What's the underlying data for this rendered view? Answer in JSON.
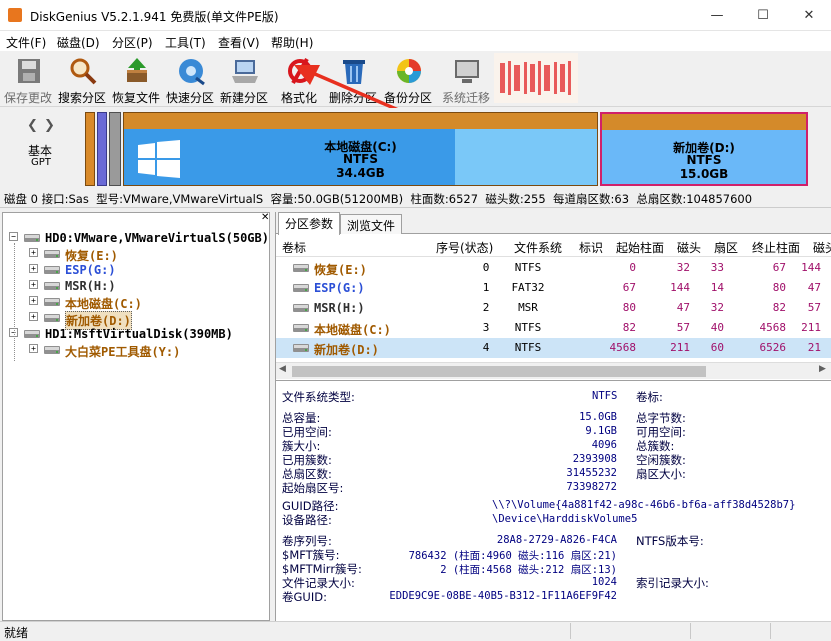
{
  "window": {
    "title": "DiskGenius V5.2.1.941 免费版(单文件PE版)"
  },
  "menu": [
    "文件(F)",
    "磁盘(D)",
    "分区(P)",
    "工具(T)",
    "查看(V)",
    "帮助(H)"
  ],
  "toolbar": [
    {
      "label": "保存更改",
      "icon": "save-icon",
      "disabled": true
    },
    {
      "label": "搜索分区",
      "icon": "search-icon",
      "disabled": false
    },
    {
      "label": "恢复文件",
      "icon": "recover-icon",
      "disabled": false
    },
    {
      "label": "快速分区",
      "icon": "quick-partition-icon",
      "disabled": false
    },
    {
      "label": "新建分区",
      "icon": "new-partition-icon",
      "disabled": false
    },
    {
      "label": "格式化",
      "icon": "format-icon",
      "disabled": false
    },
    {
      "label": "删除分区",
      "icon": "delete-icon",
      "disabled": false
    },
    {
      "label": "备份分区",
      "icon": "backup-icon",
      "disabled": false
    },
    {
      "label": "系统迁移",
      "icon": "migrate-icon",
      "disabled": true
    }
  ],
  "disk_nav": {
    "line1": "基本",
    "line2": "GPT"
  },
  "partitions_bar": [
    {
      "name": "本地磁盘(C:)",
      "fs": "NTFS",
      "size": "34.4GB"
    },
    {
      "name": "新加卷(D:)",
      "fs": "NTFS",
      "size": "15.0GB"
    }
  ],
  "disk_info": "磁盘 0 接口:Sas  型号:VMware,VMwareVirtualS  容量:50.0GB(51200MB)  柱面数:6527  磁头数:255  每道扇区数:63  总扇区数:104857600",
  "tree": [
    {
      "label": "HD0:VMware,VMwareVirtualS(50GB)",
      "level": 0,
      "color": "#000000"
    },
    {
      "label": "恢复(E:)",
      "level": 1,
      "color": "#a05a00"
    },
    {
      "label": "ESP(G:)",
      "level": 1,
      "color": "#2b4fd6"
    },
    {
      "label": "MSR(H:)",
      "level": 1,
      "color": "#303030"
    },
    {
      "label": "本地磁盘(C:)",
      "level": 1,
      "color": "#a05a00"
    },
    {
      "label": "新加卷(D:)",
      "level": 1,
      "color": "#a05a00"
    },
    {
      "label": "HD1:MsftVirtualDisk(390MB)",
      "level": 0,
      "color": "#000000"
    },
    {
      "label": "大白菜PE工具盘(Y:)",
      "level": 1,
      "color": "#a05a00"
    }
  ],
  "tabs": [
    "分区参数",
    "浏览文件"
  ],
  "table": {
    "headers": [
      "卷标",
      "序号(状态)",
      "文件系统",
      "标识",
      "起始柱面",
      "磁头",
      "扇区",
      "终止柱面",
      "磁头"
    ],
    "rows": [
      {
        "label": "恢复(E:)",
        "color": "#a05a00",
        "cells": [
          "0",
          "NTFS",
          "",
          "0",
          "32",
          "33",
          "67",
          "144"
        ]
      },
      {
        "label": "ESP(G:)",
        "color": "#2b4fd6",
        "cells": [
          "1",
          "FAT32",
          "",
          "67",
          "144",
          "14",
          "80",
          "47"
        ]
      },
      {
        "label": "MSR(H:)",
        "color": "#303030",
        "cells": [
          "2",
          "MSR",
          "",
          "80",
          "47",
          "32",
          "82",
          "57"
        ]
      },
      {
        "label": "本地磁盘(C:)",
        "color": "#a05a00",
        "cells": [
          "3",
          "NTFS",
          "",
          "82",
          "57",
          "40",
          "4568",
          "211"
        ]
      },
      {
        "label": "新加卷(D:)",
        "color": "#a05a00",
        "cells": [
          "4",
          "NTFS",
          "",
          "4568",
          "211",
          "60",
          "6526",
          "21"
        ]
      }
    ]
  },
  "details": {
    "fs_type_label": "文件系统类型:",
    "fs_type": "NTFS",
    "vol_label": "卷标:",
    "rows_a": [
      {
        "l": "总容量:",
        "v": "15.0GB",
        "r": "总字节数:"
      },
      {
        "l": "已用空间:",
        "v": "9.1GB",
        "r": "可用空间:"
      },
      {
        "l": "簇大小:",
        "v": "4096",
        "r": "总簇数:"
      },
      {
        "l": "已用簇数:",
        "v": "2393908",
        "r": "空闲簇数:"
      },
      {
        "l": "总扇区数:",
        "v": "31455232",
        "r": "扇区大小:"
      },
      {
        "l": "起始扇区号:",
        "v": "73398272",
        "r": ""
      }
    ],
    "guid_path_label": "GUID路径:",
    "guid_path": "\\\\?\\Volume{4a881f42-a98c-46b6-bf6a-aff38d4528b7}",
    "dev_path_label": "设备路径:",
    "dev_path": "\\Device\\HarddiskVolume5",
    "rows_b": [
      {
        "l": "卷序列号:",
        "v": "28A8-2729-A826-F4CA",
        "r": "NTFS版本号:"
      },
      {
        "l": "$MFT簇号:",
        "v": "786432 (柱面:4960 磁头:116 扇区:21)",
        "r": ""
      },
      {
        "l": "$MFTMirr簇号:",
        "v": "2 (柱面:4568 磁头:212 扇区:13)",
        "r": ""
      },
      {
        "l": "文件记录大小:",
        "v": "1024",
        "r": "索引记录大小:"
      },
      {
        "l": "卷GUID:",
        "v": "EDDE9C9E-08BE-40B5-B312-1F11A6EF9F42",
        "r": ""
      }
    ]
  },
  "status": "就绪"
}
